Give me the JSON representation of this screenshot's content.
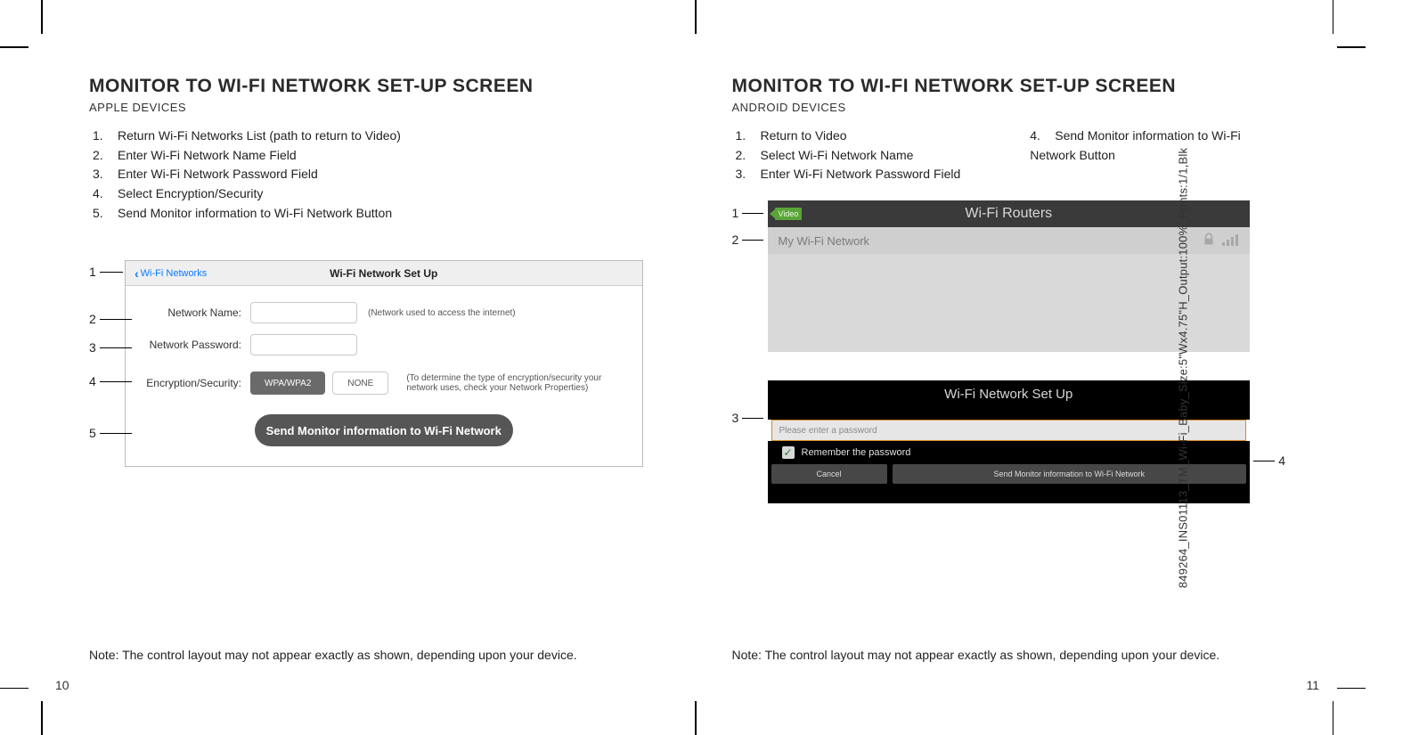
{
  "left": {
    "heading": "MONITOR TO WI-FI NETWORK SET-UP SCREEN",
    "subhead": "APPLE DEVICES",
    "steps": [
      "Return Wi-Fi Networks List (path to return to Video)",
      "Enter Wi-Fi Network Name Field",
      "Enter Wi-Fi Network Password Field",
      "Select Encryption/Security",
      "Send Monitor information to Wi-Fi Network Button"
    ],
    "ios": {
      "back_label": "Wi-Fi Networks",
      "title": "Wi-Fi Network Set Up",
      "name_label": "Network Name:",
      "name_hint": "(Network used to access the internet)",
      "pass_label": "Network Password:",
      "enc_label": "Encryption/Security:",
      "enc_wpa": "WPA/WPA2",
      "enc_none": "NONE",
      "enc_hint": "(To determine the type of encryption/security your network uses, check your Network Properties)",
      "send_label": "Send Monitor information to Wi-Fi Network"
    },
    "note": "Note: The control layout may not appear exactly as shown, depending upon your device.",
    "pagenum": "10"
  },
  "right": {
    "heading": "MONITOR TO WI-FI NETWORK SET-UP SCREEN",
    "subhead": "ANDROID DEVICES",
    "steps_col1": [
      "Return to Video",
      "Select Wi-Fi Network Name",
      "Enter Wi-Fi Network Password Field"
    ],
    "steps_col2": [
      "Send Monitor information to Wi-Fi Network Button"
    ],
    "and1": {
      "video_label": "Video",
      "title": "Wi-Fi Routers",
      "row_label": "My Wi-Fi Network"
    },
    "and2": {
      "title": "Wi-Fi Network Set Up",
      "password_placeholder": "Please enter a password",
      "remember_label": "Remember the password",
      "cancel_label": "Cancel",
      "send_label": "Send Monitor information to Wi-Fi Network"
    },
    "note": "Note: The control layout may not appear exactly as shown, depending upon your device.",
    "pagenum": "11"
  },
  "callouts": {
    "c1": "1",
    "c2": "2",
    "c3": "3",
    "c4": "4",
    "c5": "5"
  },
  "spine": "849264_INS01113_TM_Wi-Fi_Baby_Size:5\"Wx4.75\"H_Output:100%_Prints:1/1,Blk"
}
